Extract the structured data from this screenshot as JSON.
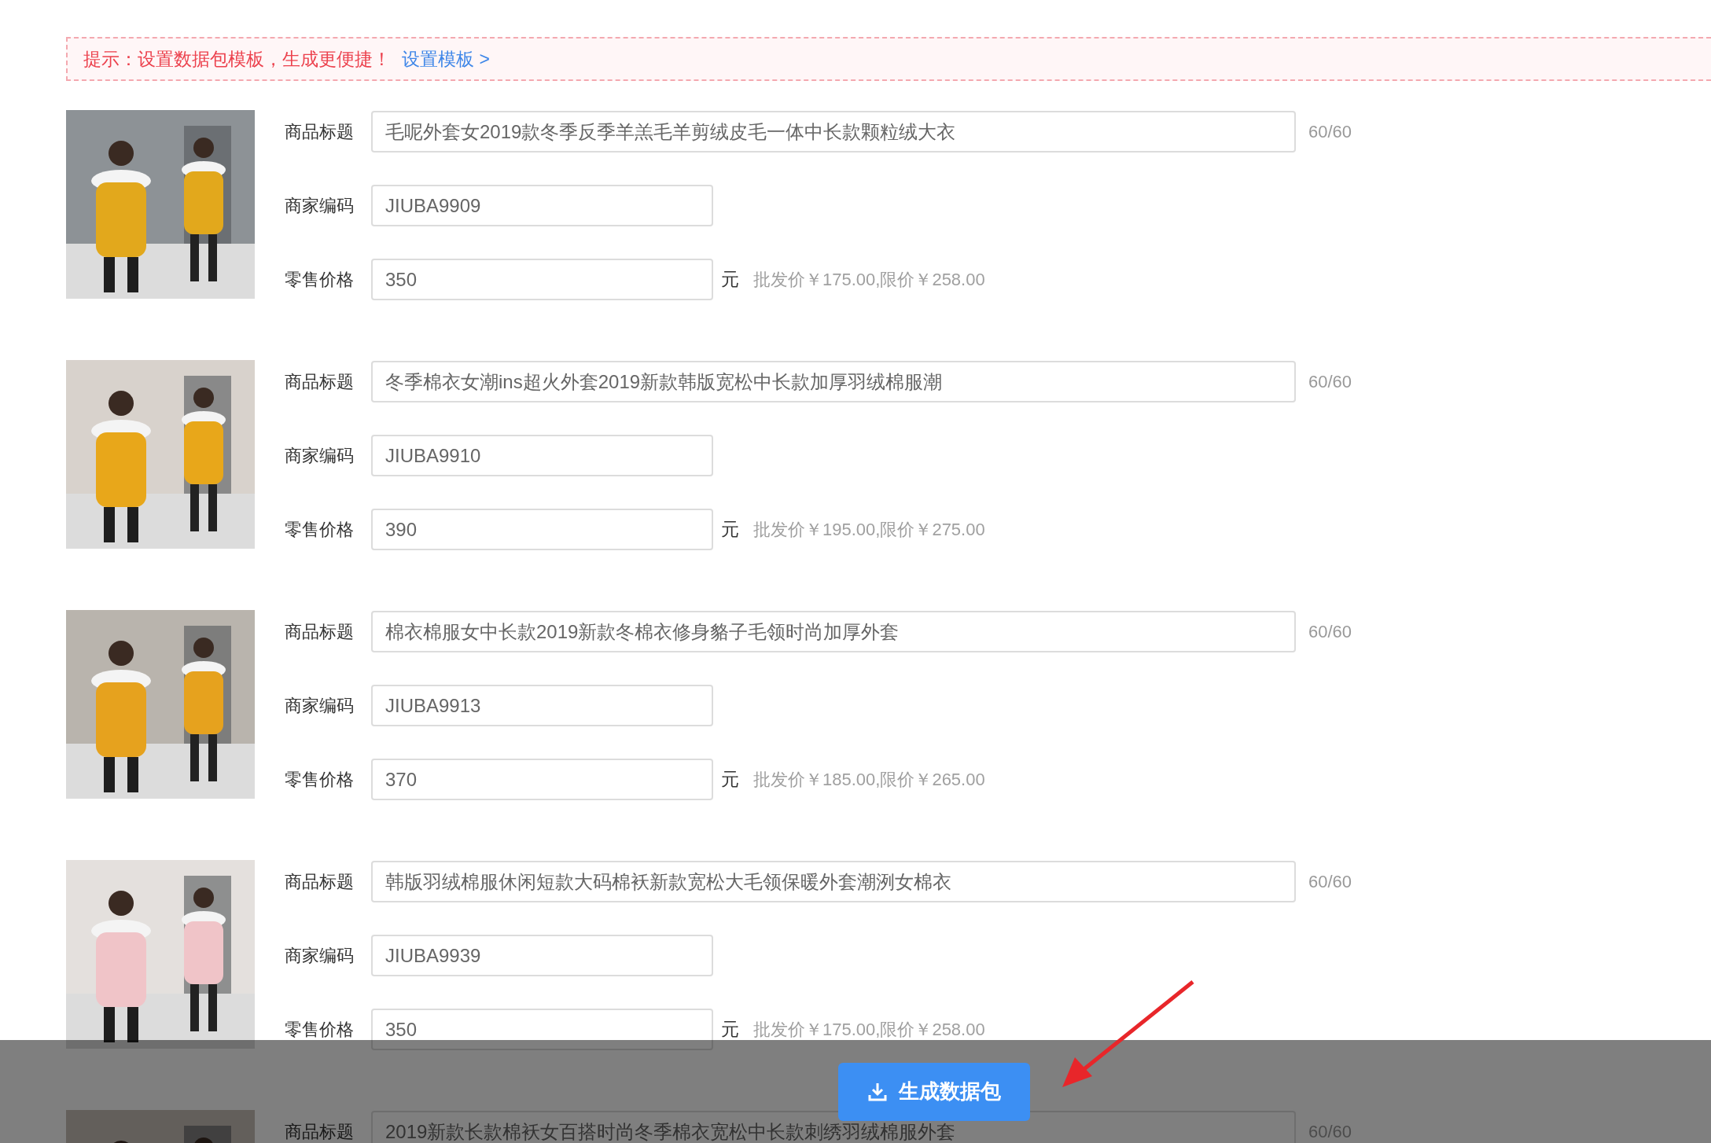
{
  "notice": {
    "text": "提示：设置数据包模板，生成更便捷！",
    "link": "设置模板",
    "link_arrow": ">"
  },
  "products": [
    {
      "title_label": "商品标题",
      "title": "毛呢外套女2019款冬季反季羊羔毛羊剪绒皮毛一体中长款颗粒绒大衣",
      "count": "60/60",
      "code_label": "商家编码",
      "code": "JIUBA9909",
      "price_label": "零售价格",
      "price": "350",
      "unit": "元",
      "price_note": "批发价￥175.00,限价￥258.00"
    },
    {
      "title_label": "商品标题",
      "title": "冬季棉衣女潮ins超火外套2019新款韩版宽松中长款加厚羽绒棉服潮",
      "count": "60/60",
      "code_label": "商家编码",
      "code": "JIUBA9910",
      "price_label": "零售价格",
      "price": "390",
      "unit": "元",
      "price_note": "批发价￥195.00,限价￥275.00"
    },
    {
      "title_label": "商品标题",
      "title": "棉衣棉服女中长款2019新款冬棉衣修身貉子毛领时尚加厚外套",
      "count": "60/60",
      "code_label": "商家编码",
      "code": "JIUBA9913",
      "price_label": "零售价格",
      "price": "370",
      "unit": "元",
      "price_note": "批发价￥185.00,限价￥265.00"
    },
    {
      "title_label": "商品标题",
      "title": "韩版羽绒棉服休闲短款大码棉袄新款宽松大毛领保暖外套潮洌女棉衣",
      "count": "60/60",
      "code_label": "商家编码",
      "code": "JIUBA9939",
      "price_label": "零售价格",
      "price": "350",
      "unit": "元",
      "price_note": "批发价￥175.00,限价￥258.00"
    },
    {
      "title_label": "商品标题",
      "title": "2019新款长款棉袄女百搭时尚冬季棉衣宽松中长款刺绣羽绒棉服外套",
      "count": "60/60"
    }
  ],
  "footer": {
    "button": "生成数据包"
  }
}
